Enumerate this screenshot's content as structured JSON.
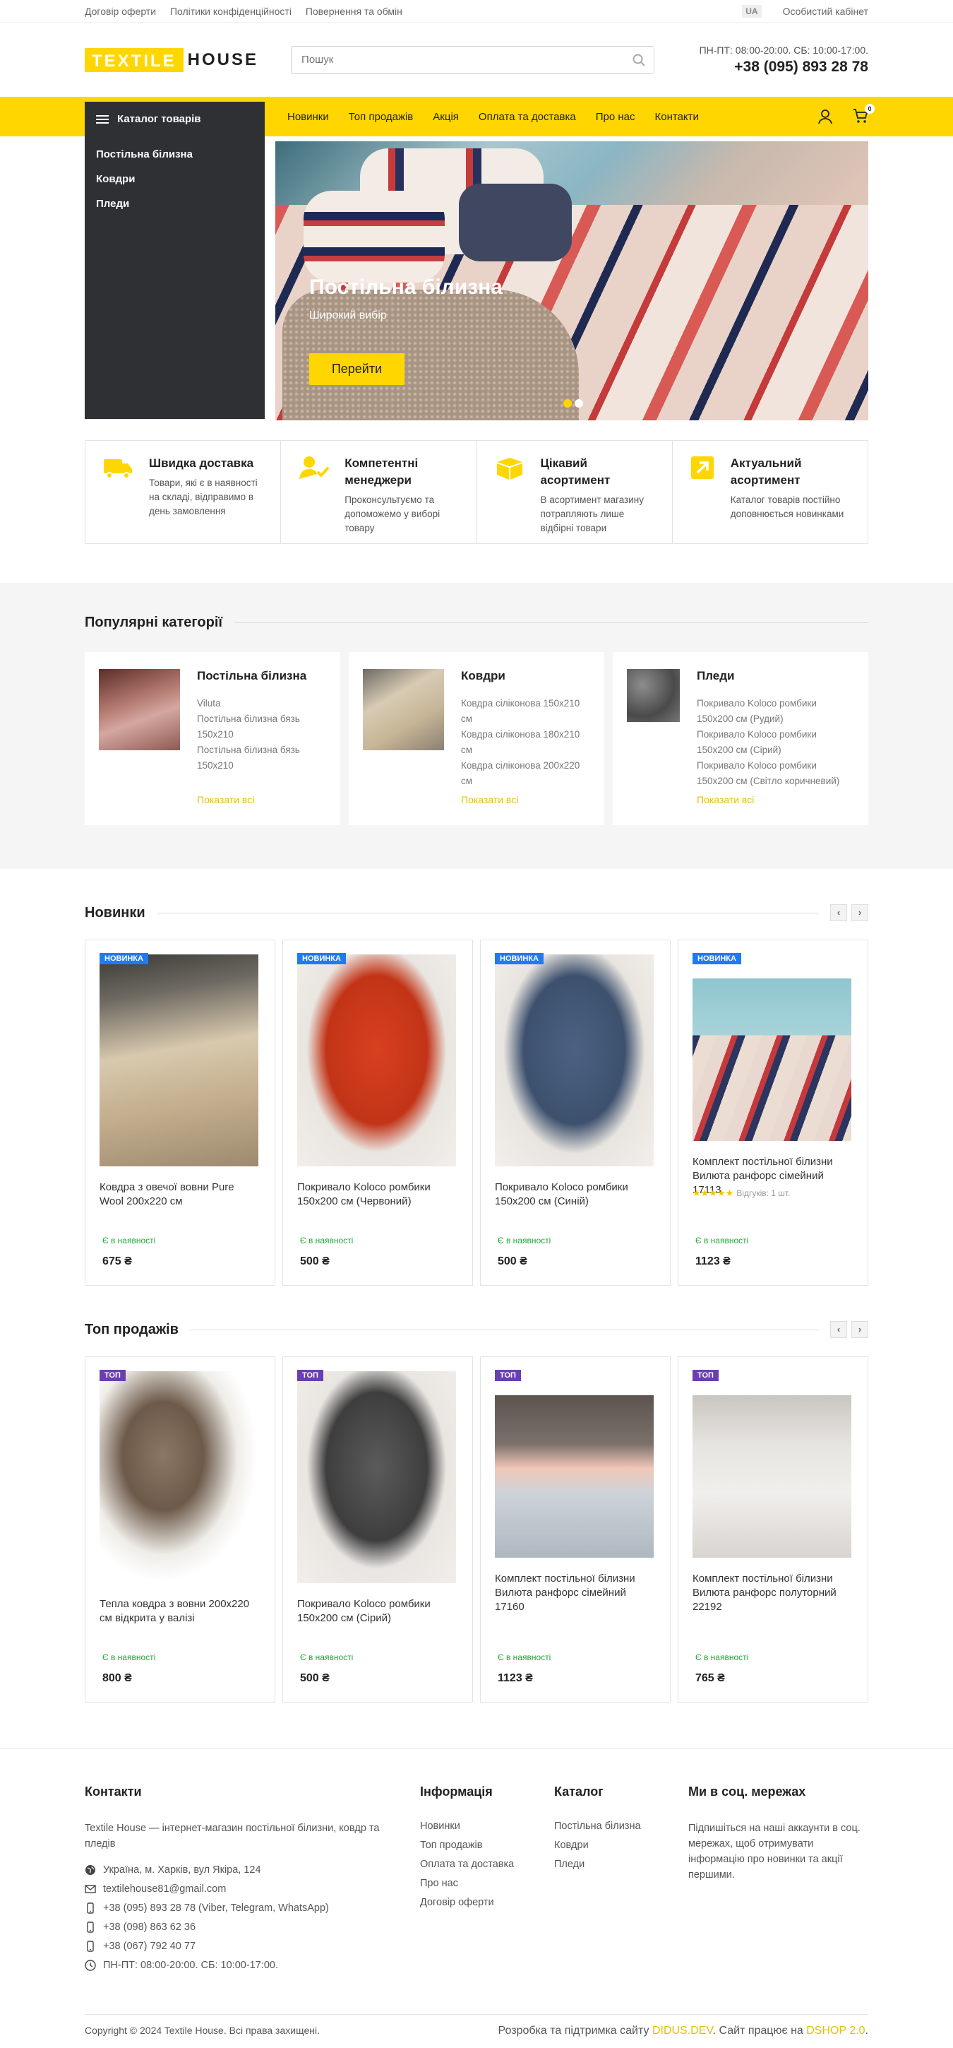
{
  "topbar": {
    "links": [
      "Договір оферти",
      "Політики конфіденційності",
      "Повернення та обмін"
    ],
    "lang": "UA",
    "account": "Особистий кабінет"
  },
  "header": {
    "logo_part1": "TEXTILE",
    "logo_part2": "HOUSE",
    "search_placeholder": "Пошук",
    "hours": "ПН-ПТ: 08:00-20:00. СБ: 10:00-17:00.",
    "phone": "+38 (095) 893 28 78"
  },
  "nav": {
    "catalog": "Каталог товарів",
    "menu": [
      "Новинки",
      "Топ продажів",
      "Акція",
      "Оплата та доставка",
      "Про нас",
      "Контакти"
    ],
    "cart_count": "0"
  },
  "sidebar": {
    "items": [
      "Постільна білизна",
      "Ковдри",
      "Пледи"
    ]
  },
  "hero": {
    "title": "Постільна білизна",
    "subtitle": "Широкий вибір",
    "button": "Перейти",
    "active_slide": 1,
    "slides": 2
  },
  "features": [
    {
      "icon": "truck-icon",
      "title": "Швидка доставка",
      "text": "Товари, які є в наявності на складі, відправимо в день замовлення"
    },
    {
      "icon": "manager-icon",
      "title": "Компетентні менеджери",
      "text": "Проконсультуємо та допоможемо у виборі товару"
    },
    {
      "icon": "box-icon",
      "title": "Цікавий асортимент",
      "text": "В асортимент магазину потрапляють лише відбірні товари"
    },
    {
      "icon": "arrow-up-right-icon",
      "title": "Актуальний асортимент",
      "text": "Каталог товарів постійно доповнюється новинками"
    }
  ],
  "popular": {
    "title": "Популярні категорії",
    "show_all": "Показати всі",
    "cards": [
      {
        "title": "Постільна білизна",
        "items": [
          "Viluta",
          "Постільна білизна бязь 150x210",
          "Постільна білизна бязь 150x210"
        ]
      },
      {
        "title": "Ковдри",
        "items": [
          "Ковдра сіліконова 150x210 см",
          "Ковдра сіліконова 180x210 см",
          "Ковдра сіліконова 200x220 см"
        ]
      },
      {
        "title": "Пледи",
        "items": [
          "Покривало Koloco ромбики 150x200 см (Рудий)",
          "Покривало Koloco ромбики 150x200 см (Сірий)",
          "Покривало Koloco ромбики 150x200 см (Світло коричневий)"
        ]
      }
    ]
  },
  "new_products": {
    "title": "Новинки",
    "tag": "НОВИНКА",
    "items": [
      {
        "name": "Ковдра з овечої вовни Pure Wool 200x220 см",
        "avail": "Є в наявності",
        "price": "675 ₴"
      },
      {
        "name": "Покривало Koloco ромбики 150x200 см (Червоний)",
        "avail": "Є в наявності",
        "price": "500 ₴"
      },
      {
        "name": "Покривало Koloco ромбики 150x200 см (Синій)",
        "avail": "Є в наявності",
        "price": "500 ₴"
      },
      {
        "name": "Комплект постільної білизни Вилюта ранфорс сімейний 17113",
        "avail": "Є в наявності",
        "price": "1123 ₴",
        "rating": 5,
        "reviews": "Відгуків: 1 шт."
      }
    ]
  },
  "top_products": {
    "title": "Топ продажів",
    "tag": "ТОП",
    "items": [
      {
        "name": "Тепла ковдра з вовни 200x220 см відкрита у валізі",
        "avail": "Є в наявності",
        "price": "800 ₴"
      },
      {
        "name": "Покривало Koloco ромбики 150x200 см (Сірий)",
        "avail": "Є в наявності",
        "price": "500 ₴"
      },
      {
        "name": "Комплект постільної білизни Вилюта ранфорс сімейний 17160",
        "avail": "Є в наявності",
        "price": "1123 ₴"
      },
      {
        "name": "Комплект постільної білизни Вилюта ранфорс полуторний 22192",
        "avail": "Є в наявності",
        "price": "765 ₴"
      }
    ]
  },
  "footer": {
    "contacts_title": "Контакти",
    "about": "Textile House — інтернет-магазин постільної білизни, ковдр та пледів",
    "address": "Україна, м. Харків, вул Якіра, 124",
    "email": "textilehouse81@gmail.com",
    "phones": [
      "+38 (095) 893 28 78 (Viber, Telegram, WhatsApp)",
      "+38 (098) 863 62 36",
      "+38 (067) 792 40 77"
    ],
    "hours": "ПН-ПТ: 08:00-20:00. СБ: 10:00-17:00.",
    "info_title": "Інформація",
    "info_links": [
      "Новинки",
      "Топ продажів",
      "Оплата та доставка",
      "Про нас",
      "Договір оферти"
    ],
    "catalog_title": "Каталог",
    "catalog_links": [
      "Постільна білизна",
      "Ковдри",
      "Пледи"
    ],
    "social_title": "Ми в соц. мережах",
    "social_text": "Підпишіться на наші аккаунти в соц. мережах, щоб отримувати інформацію про новинки та акції першими.",
    "copyright": "Copyright © 2024 Textile House. Всі права захищені.",
    "dev_text1": "Розробка та підтримка сайту",
    "dev_name": "DIDUS.DEV",
    "dev_text2": ". Сайт працює на",
    "engine": "DSHOP 2.0",
    "dot": "."
  },
  "colors": {
    "accent": "#ffd600",
    "dark": "#2f3034",
    "green": "#1ea838",
    "new_tag": "#1f7af3",
    "top_tag": "#6a3fb4"
  }
}
